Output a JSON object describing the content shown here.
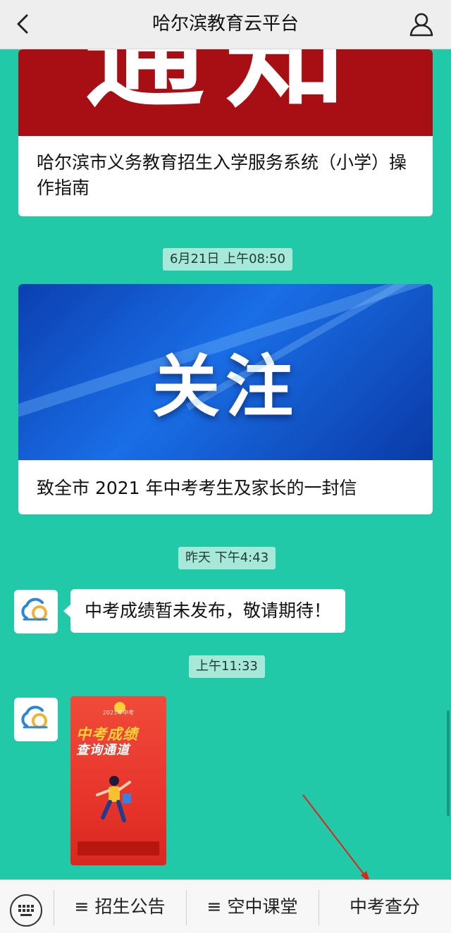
{
  "header": {
    "title": "哈尔滨教育云平台",
    "back_icon": "chevron-left-icon",
    "user_icon": "user-icon"
  },
  "messages": {
    "card1": {
      "banner_text": "通知",
      "caption": "哈尔滨市义务教育招生入学服务系统（小学）操作指南"
    },
    "stamp1": "6月21日 上午08:50",
    "card2": {
      "banner_text": "关注",
      "caption": "致全市 2021 年中考考生及家长的一封信"
    },
    "stamp2": "昨天 下午4:43",
    "bubble_text": "中考成绩暂未发布，敬请期待！",
    "stamp3": "上午11:33",
    "poster": {
      "year_text": "2021年中考",
      "title_line1": "中考成绩",
      "title_line2": "查询通道"
    }
  },
  "menu": {
    "keyboard_icon": "keyboard-icon",
    "item1": "≡ 招生公告",
    "item2": "≡ 空中课堂",
    "item3": "中考查分"
  },
  "colors": {
    "background": "#22c9a8",
    "notice_banner": "#a80f14",
    "highlight": "#e0241b"
  }
}
